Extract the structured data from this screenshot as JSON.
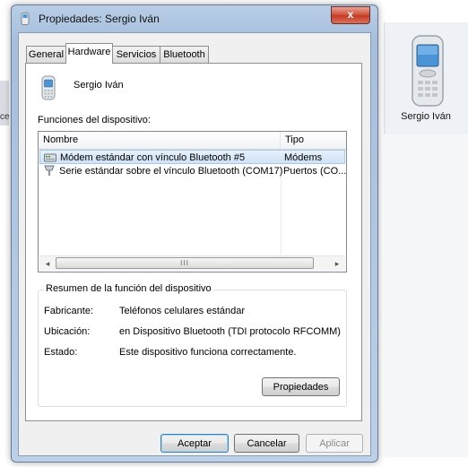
{
  "window": {
    "title": "Propiedades: Sergio Iván",
    "close_label": "x"
  },
  "tabs": [
    {
      "label": "General",
      "active": false
    },
    {
      "label": "Hardware",
      "active": true
    },
    {
      "label": "Servicios",
      "active": false
    },
    {
      "label": "Bluetooth",
      "active": false
    }
  ],
  "device": {
    "name": "Sergio Iván",
    "icon": "mobile-phone-icon"
  },
  "functions": {
    "label": "Funciones del dispositivo:",
    "columns": [
      "Nombre",
      "Tipo"
    ],
    "rows": [
      {
        "name": "Módem estándar con vínculo Bluetooth #5",
        "type": "Módems",
        "icon": "modem-icon",
        "selected": true
      },
      {
        "name": "Serie estándar sobre el vínculo Bluetooth (COM17)",
        "type": "Puertos (CO...",
        "icon": "serial-port-icon",
        "selected": false
      }
    ],
    "scroll_grip": "III"
  },
  "summary": {
    "title": "Resumen de la función del dispositivo",
    "rows": [
      {
        "label": "Fabricante:",
        "value": "Teléfonos celulares estándar"
      },
      {
        "label": "Ubicación:",
        "value": "en Dispositivo Bluetooth (TDI protocolo RFCOMM)"
      },
      {
        "label": "Estado:",
        "value": "Este dispositivo funciona correctamente."
      }
    ],
    "properties_button": "Propiedades"
  },
  "footer": {
    "ok": "Aceptar",
    "cancel": "Cancelar",
    "apply": "Aplicar"
  },
  "background": {
    "desktop_item_label": "Sergio Iván",
    "left_fragment": "ce"
  },
  "colors": {
    "selection": "#cfe3f7",
    "close": "#c23a22",
    "frame": "#a6bfdd"
  }
}
